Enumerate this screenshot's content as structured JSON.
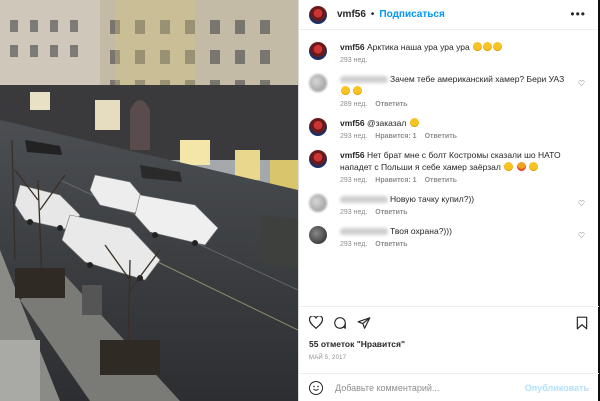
{
  "post": {
    "username": "vmf56",
    "dot": "•",
    "follow_label": "Подписаться",
    "more_label": "•••"
  },
  "comments": [
    {
      "user": "vmf56",
      "text": "Арктика наша ура ура ура",
      "emojis": 3,
      "time": "293 нед.",
      "likes": "",
      "reply": "",
      "avatar": "flag",
      "blurred": false
    },
    {
      "user": "",
      "text": "Зачем тебе американский хамер? Бери УАЗ",
      "emojis": 2,
      "time": "289 нед.",
      "likes": "",
      "reply": "Ответить",
      "avatar": "blur",
      "blurred": true
    },
    {
      "user": "vmf56",
      "text": "@заказал",
      "emojis": 1,
      "time": "293 нед.",
      "likes": "Нравится: 1",
      "reply": "Ответить",
      "avatar": "flag",
      "blurred": false
    },
    {
      "user": "vmf56",
      "text": "Нет брат мне с болт Костромы сказали шо НАТО нападет с Польши я себе хамер заёрзал",
      "emojis": 3,
      "time": "293 нед.",
      "likes": "Нравится: 1",
      "reply": "Ответить",
      "avatar": "flag",
      "blurred": false
    },
    {
      "user": "",
      "text": "Новую тачку купил?))",
      "emojis": 0,
      "time": "293 нед.",
      "likes": "",
      "reply": "Ответить",
      "avatar": "blur",
      "blurred": true
    },
    {
      "user": "",
      "text": "Твоя охрана?)))",
      "emojis": 0,
      "time": "293 нед.",
      "likes": "",
      "reply": "Ответить",
      "avatar": "dark",
      "blurred": true
    }
  ],
  "actions": {
    "likes_text": "55 отметок \"Нравится\"",
    "date_text": "МАЙ 5, 2017",
    "comment_placeholder": "Добавьте комментарий...",
    "publish_label": "Опубликовать"
  },
  "colors": {
    "link_blue": "#0095f6",
    "muted": "#8e8e8e",
    "text": "#262626"
  }
}
